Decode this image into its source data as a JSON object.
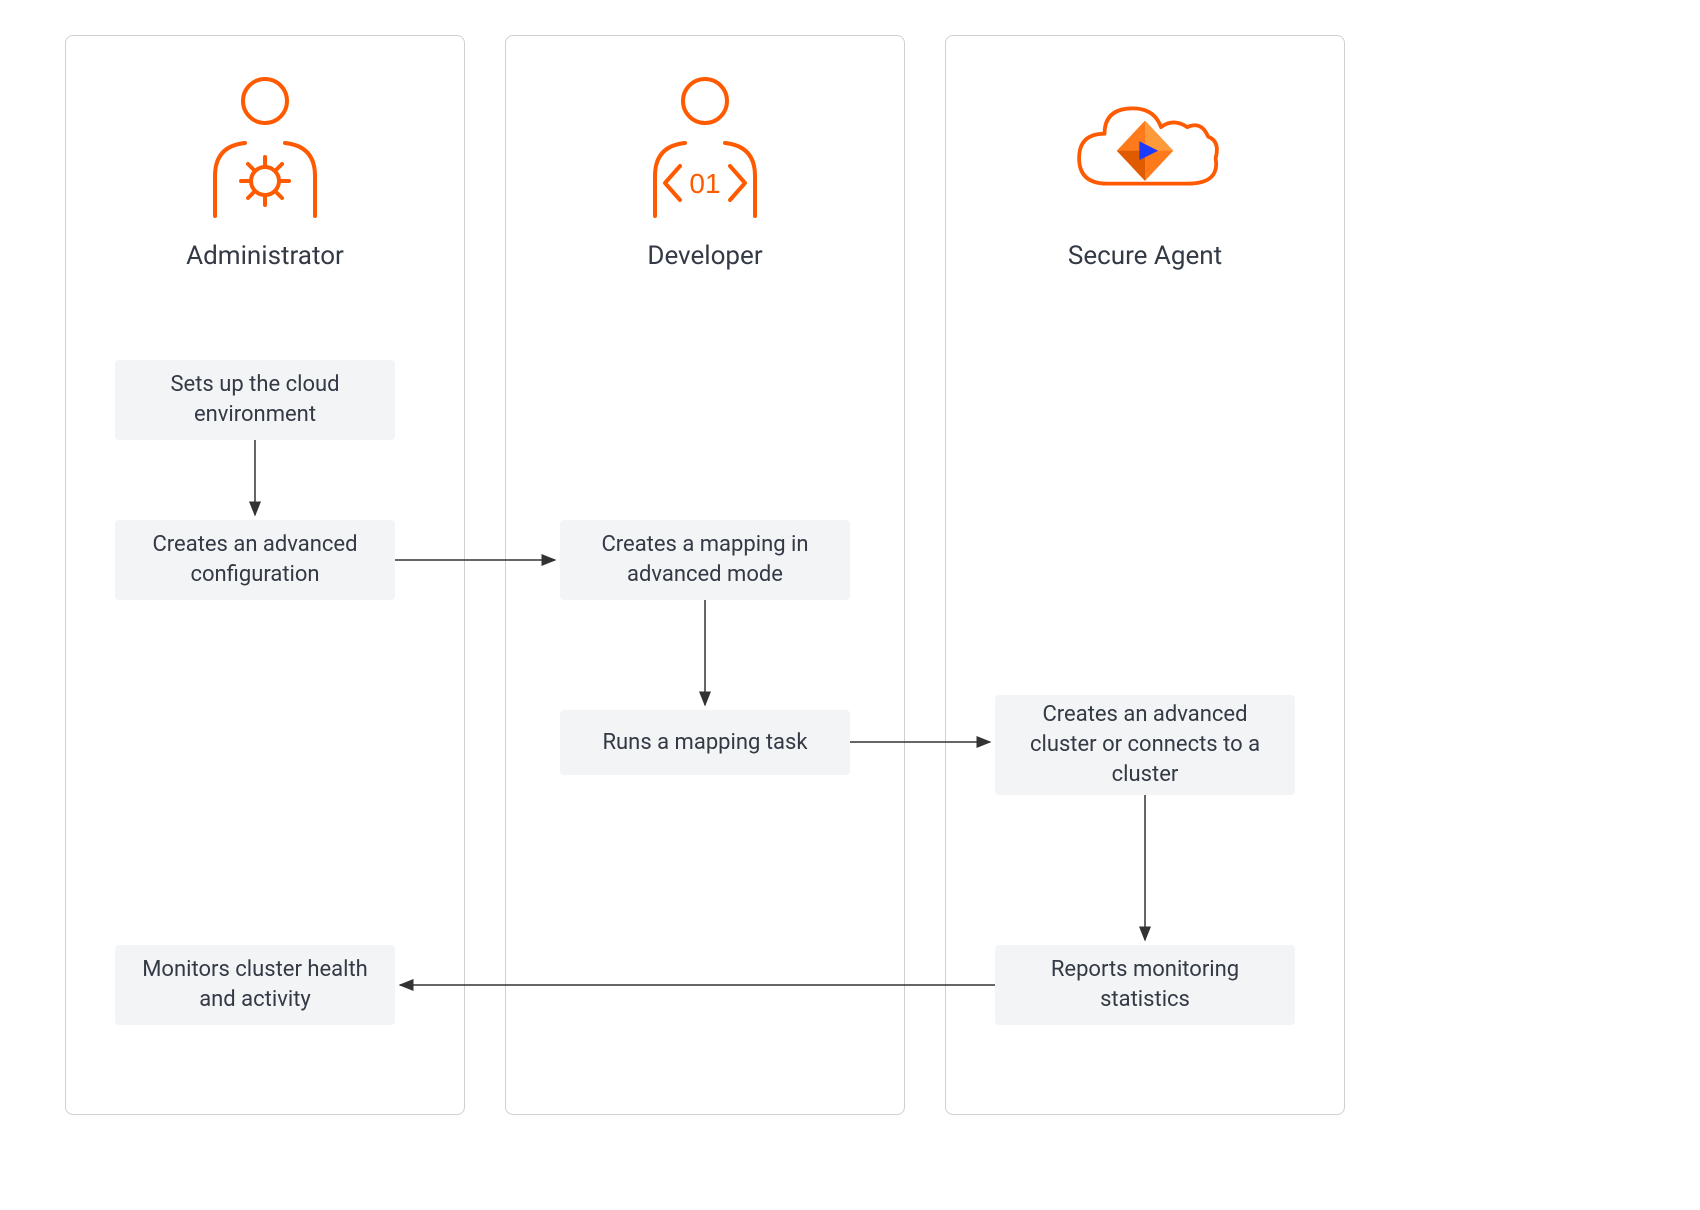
{
  "columns": {
    "admin": {
      "title": "Administrator"
    },
    "developer": {
      "title": "Developer"
    },
    "agent": {
      "title": "Secure Agent"
    }
  },
  "steps": {
    "admin_step1": "Sets up the cloud environment",
    "admin_step2": "Creates an advanced configuration",
    "admin_step3": "Monitors cluster health and activity",
    "dev_step1": "Creates a mapping in advanced mode",
    "dev_step2": "Runs a mapping task",
    "agent_step1": "Creates an advanced cluster or connects to a cluster",
    "agent_step2": "Reports monitoring statistics"
  },
  "colors": {
    "accent": "#ff5a00",
    "text": "#333a45",
    "box": "#f3f4f6",
    "border": "#d0d0d0"
  }
}
